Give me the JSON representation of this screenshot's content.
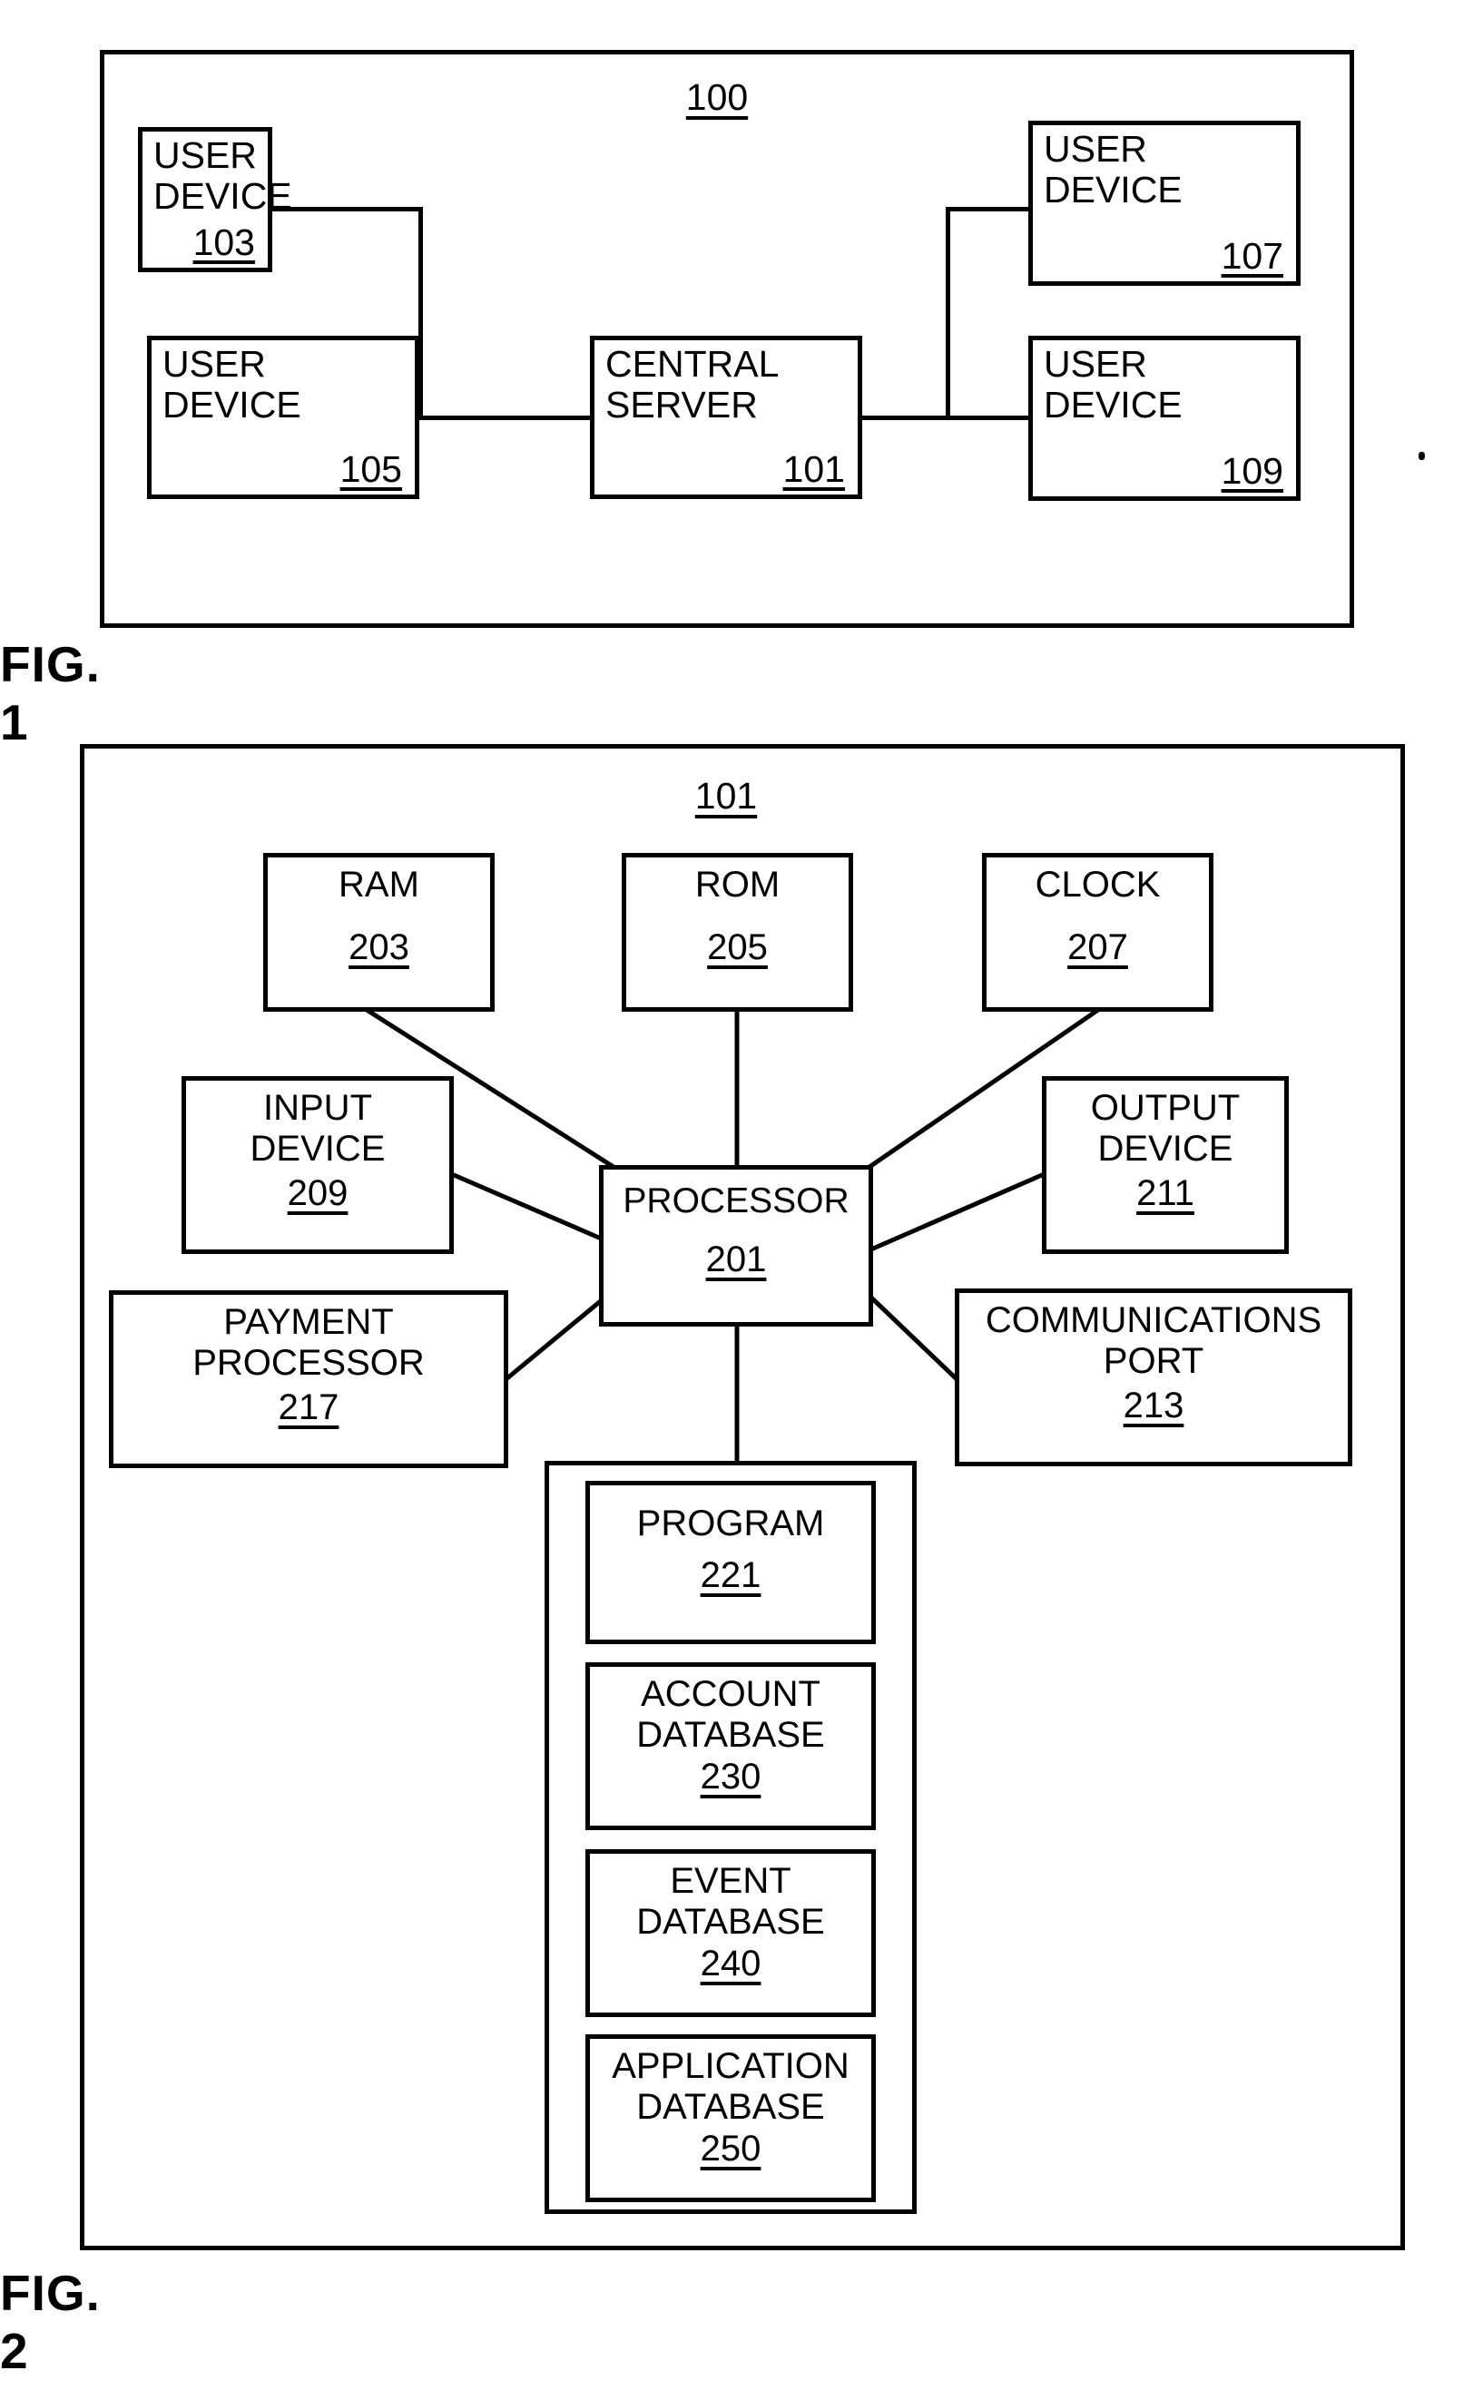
{
  "document": {
    "type": "patent-drawing-sheet",
    "figures": [
      "FIG. 1",
      "FIG. 2"
    ]
  },
  "figure1": {
    "caption": "FIG. 1",
    "system_ref": "100",
    "nodes": {
      "user_device_103": {
        "label": "USER\nDEVICE",
        "ref": "103"
      },
      "user_device_105": {
        "label": "USER\nDEVICE",
        "ref": "105"
      },
      "central_server_101": {
        "label": "CENTRAL\nSERVER",
        "ref": "101"
      },
      "user_device_107": {
        "label": "USER\nDEVICE",
        "ref": "107"
      },
      "user_device_109": {
        "label": "USER\nDEVICE",
        "ref": "109"
      }
    },
    "connections": [
      {
        "from": "user_device_103",
        "to": "central_server_101"
      },
      {
        "from": "user_device_105",
        "to": "central_server_101"
      },
      {
        "from": "central_server_101",
        "to": "user_device_107"
      },
      {
        "from": "central_server_101",
        "to": "user_device_109"
      }
    ]
  },
  "figure2": {
    "caption": "FIG. 2",
    "system_ref": "101",
    "nodes": {
      "ram_203": {
        "label": "RAM",
        "ref": "203"
      },
      "rom_205": {
        "label": "ROM",
        "ref": "205"
      },
      "clock_207": {
        "label": "CLOCK",
        "ref": "207"
      },
      "input_device_209": {
        "label": "INPUT\nDEVICE",
        "ref": "209"
      },
      "processor_201": {
        "label": "PROCESSOR",
        "ref": "201"
      },
      "output_device_211": {
        "label": "OUTPUT\nDEVICE",
        "ref": "211"
      },
      "payment_processor_217": {
        "label": "PAYMENT\nPROCESSOR",
        "ref": "217"
      },
      "communications_port_213": {
        "label": "COMMUNICATIONS\nPORT",
        "ref": "213"
      },
      "program_221": {
        "label": "PROGRAM",
        "ref": "221"
      },
      "account_database_230": {
        "label": "ACCOUNT\nDATABASE",
        "ref": "230"
      },
      "event_database_240": {
        "label": "EVENT\nDATABASE",
        "ref": "240"
      },
      "application_database_250": {
        "label": "APPLICATION\nDATABASE",
        "ref": "250"
      }
    },
    "connections": [
      {
        "from": "ram_203",
        "to": "processor_201"
      },
      {
        "from": "rom_205",
        "to": "processor_201"
      },
      {
        "from": "clock_207",
        "to": "processor_201"
      },
      {
        "from": "input_device_209",
        "to": "processor_201"
      },
      {
        "from": "output_device_211",
        "to": "processor_201"
      },
      {
        "from": "payment_processor_217",
        "to": "processor_201"
      },
      {
        "from": "communications_port_213",
        "to": "processor_201"
      },
      {
        "from": "processor_201",
        "to": "storage_container"
      }
    ]
  },
  "colors": {
    "ink": "#000000",
    "paper": "#ffffff"
  }
}
